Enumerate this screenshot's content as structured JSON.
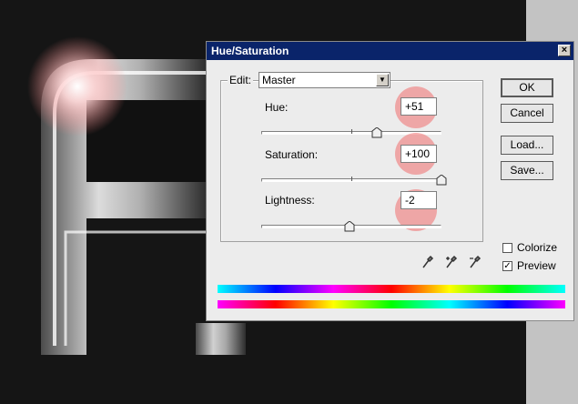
{
  "dialog": {
    "title": "Hue/Saturation",
    "close_glyph": "×",
    "edit_label": "Edit:",
    "edit_value": "Master",
    "hue": {
      "label": "Hue:",
      "value": "+51",
      "level": 0.64
    },
    "saturation": {
      "label": "Saturation:",
      "value": "+100",
      "level": 1.0
    },
    "lightness": {
      "label": "Lightness:",
      "value": "-2",
      "level": 0.49
    },
    "buttons": {
      "ok": "OK",
      "cancel": "Cancel",
      "load": "Load...",
      "save": "Save..."
    },
    "colorize": {
      "label": "Colorize",
      "checked": false
    },
    "preview": {
      "label": "Preview",
      "checked": true,
      "check_glyph": "✓"
    },
    "icons": [
      "eyedropper-icon",
      "eyedropper-plus-icon",
      "eyedropper-minus-icon"
    ]
  },
  "colors": {
    "titlebar": "#0a246a",
    "highlight": "#f06e6e",
    "dialog_bg": "#ececec"
  }
}
